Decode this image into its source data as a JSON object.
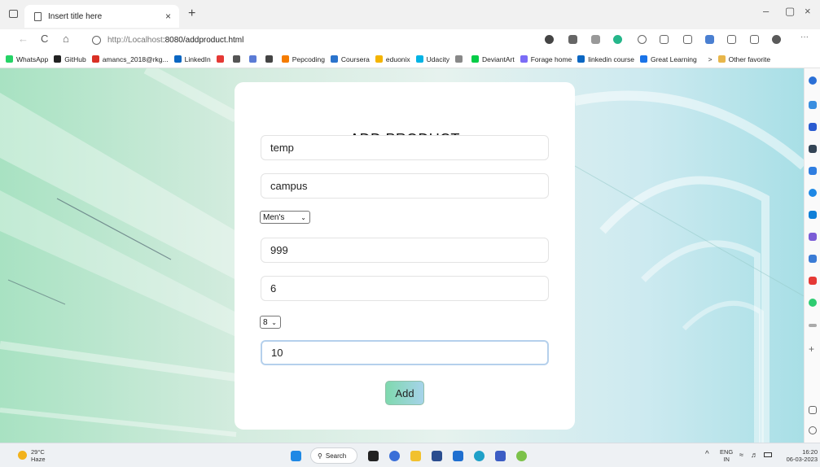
{
  "browser": {
    "tab_title": "Insert title here",
    "tab_close": "×",
    "new_tab": "+",
    "url_host": "http://Localhost",
    "url_path": ":8080/addproduct.html",
    "window_controls": [
      "–",
      "▢",
      "×"
    ],
    "nav": {
      "back": "←",
      "refresh": "C",
      "home": "⌂"
    },
    "more": "···"
  },
  "bookmarks": {
    "items": [
      {
        "label": "WhatsApp",
        "color": "#25d366"
      },
      {
        "label": "GitHub",
        "color": "#222222"
      },
      {
        "label": "amancs_2018@rkg...",
        "color": "#d93025"
      },
      {
        "label": "LinkedIn",
        "color": "#0a66c2"
      },
      {
        "label": "",
        "color": "#e53935"
      },
      {
        "label": "",
        "color": "#555555"
      },
      {
        "label": "",
        "color": "#5b7bd5"
      },
      {
        "label": "",
        "color": "#444444"
      },
      {
        "label": "Pepcoding",
        "color": "#f57c00"
      },
      {
        "label": "Coursera",
        "color": "#2a73cc"
      },
      {
        "label": "eduonix",
        "color": "#f4b400"
      },
      {
        "label": "Udacity",
        "color": "#02b3e4"
      },
      {
        "label": "",
        "color": "#888888"
      },
      {
        "label": "DeviantArt",
        "color": "#05cc47"
      },
      {
        "label": "Forage home",
        "color": "#7b6cf6"
      },
      {
        "label": "linkedin course",
        "color": "#0a66c2"
      },
      {
        "label": "Great Learning",
        "color": "#1a73e8"
      }
    ],
    "overflow": ">",
    "other": "Other favorite"
  },
  "form": {
    "title": "ADD PRODUCT",
    "name_value": "temp",
    "brand_value": "campus",
    "category_selected": "Men's",
    "price_value": "999",
    "field5_value": "6",
    "size_selected": "8",
    "field7_value": "10",
    "submit_label": "Add"
  },
  "taskbar": {
    "weather_temp": "29°C",
    "weather_desc": "Haze",
    "search_label": "Search",
    "lang_top": "ENG",
    "lang_bottom": "IN",
    "time": "16:20",
    "date": "06-03-2023",
    "tray_chevron": "^"
  },
  "colors": {
    "accent_button_start": "#7fd9ae",
    "accent_button_end": "#a6d3ea",
    "focus_border": "#b5d0ec"
  }
}
